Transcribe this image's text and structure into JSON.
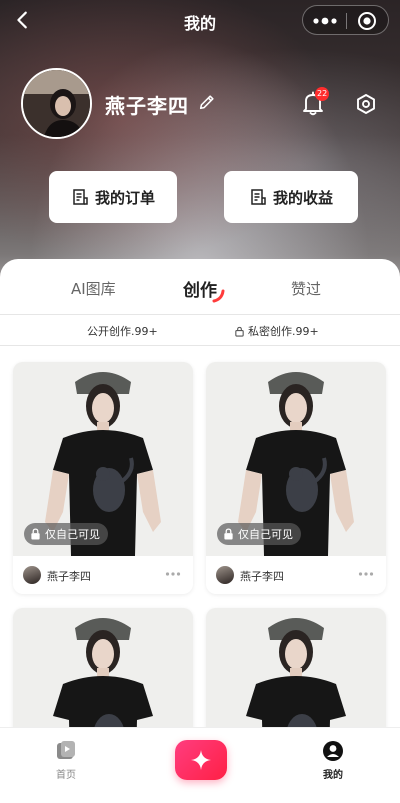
{
  "nav": {
    "title": "我的"
  },
  "profile": {
    "username": "燕子李四",
    "notification_count": "22"
  },
  "actions": {
    "orders": "我的订单",
    "earnings": "我的收益"
  },
  "tabs": {
    "ai_library": "AI图库",
    "create": "创作",
    "liked": "赞过"
  },
  "subtabs": {
    "public": "公开创作.99+",
    "private": "私密创作.99+"
  },
  "cards": [
    {
      "tag": "仅自己可见",
      "author": "燕子李四"
    },
    {
      "tag": "仅自己可见",
      "author": "燕子李四"
    },
    {
      "tag": "",
      "author": ""
    },
    {
      "tag": "",
      "author": ""
    }
  ],
  "tabbar": {
    "home": "首页",
    "mine": "我的"
  },
  "colors": {
    "accent": "#ff2d55",
    "badge": "#ff2d2d"
  }
}
